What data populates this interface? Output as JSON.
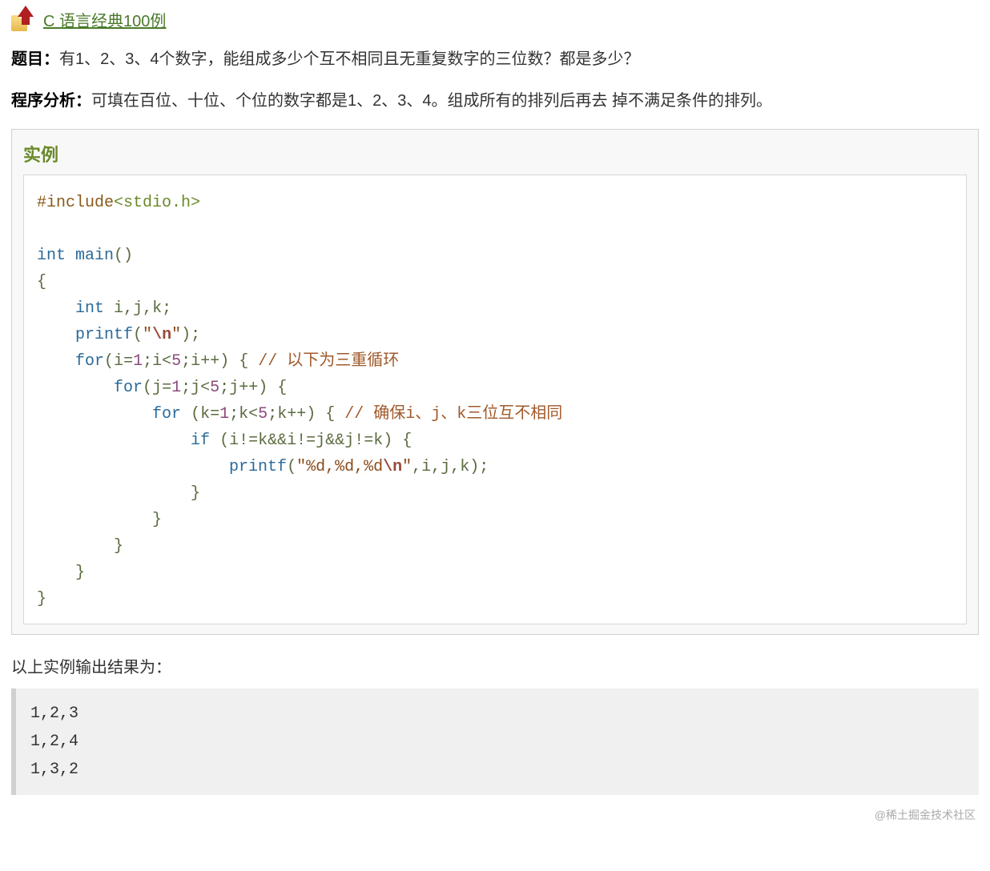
{
  "breadcrumb": {
    "label": "C 语言经典100例",
    "href": "#"
  },
  "question": {
    "label": "题目：",
    "text": "有1、2、3、4个数字，能组成多少个互不相同且无重复数字的三位数？都是多少？"
  },
  "analysis": {
    "label": "程序分析：",
    "text": "可填在百位、十位、个位的数字都是1、2、3、4。组成所有的排列后再去 掉不满足条件的排列。"
  },
  "example": {
    "title": "实例",
    "code": {
      "include_kw": "#include",
      "include_hdr": "<stdio.h>",
      "kw_int": "int",
      "fn_main": "main",
      "fn_printf": "printf",
      "kw_for": "for",
      "kw_if": "if",
      "id_i": "i",
      "id_j": "j",
      "id_k": "k",
      "num_1": "1",
      "num_5": "5",
      "str_nl_open": "\"",
      "esc_n": "\\n",
      "str_nl_close": "\"",
      "str_fmt_open": "\"",
      "str_fmt_body": "%d,%d,%d",
      "str_fmt_close": "\"",
      "cmt1": "// 以下为三重循环",
      "cmt2": "// 确保i、j、k三位互不相同"
    }
  },
  "output": {
    "label": "以上实例输出结果为：",
    "lines": "1,2,3\n1,2,4\n1,3,2"
  },
  "watermark": "@稀土掘金技术社区"
}
